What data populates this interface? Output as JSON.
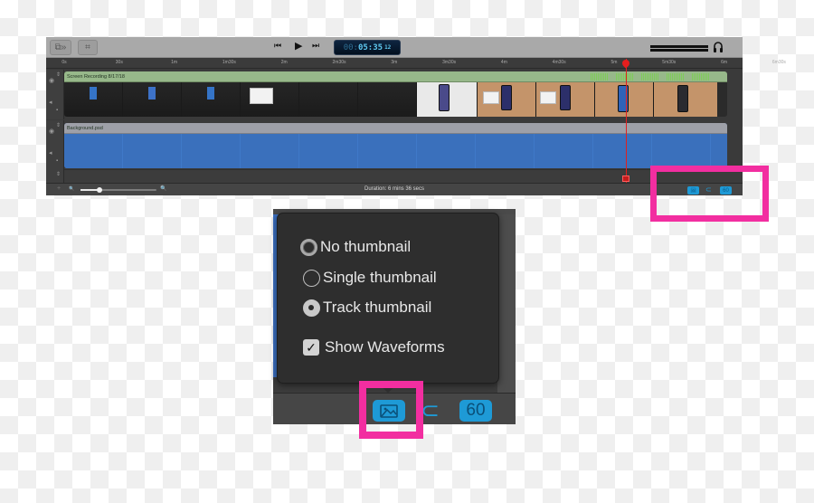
{
  "toolbar": {
    "left_buttons": [
      {
        "icon": "media-library-icon",
        "glyph": "⧉»"
      },
      {
        "icon": "crop-icon",
        "glyph": "⌗"
      }
    ],
    "transport": {
      "rewind_glyph": "⏮",
      "play_glyph": "▶",
      "forward_glyph": "⏭"
    },
    "timecode": {
      "hours": "00:",
      "main": "05:35",
      "frames": "12"
    },
    "headphones_icon": "headphones-icon"
  },
  "ruler": {
    "ticks": [
      "0s",
      "30s",
      "1m",
      "1m30s",
      "2m",
      "2m30s",
      "3m",
      "3m30s",
      "4m",
      "4m30s",
      "5m",
      "5m30s",
      "6m",
      "6m30s"
    ]
  },
  "playhead": {
    "time": "5m35s"
  },
  "tracks": [
    {
      "name": "Screen Recording 8/17/18",
      "type": "video",
      "color": "#97b88a"
    },
    {
      "name": "Background.psd",
      "type": "image",
      "color": "#3d75c4"
    }
  ],
  "statusbar": {
    "duration": "Duration: 6 mins 36 secs",
    "add_glyph": "+",
    "zoom_out_glyph": "🔍",
    "zoom_in_glyph": "🔍",
    "zoom_level": 0.25,
    "thumbnail_glyph": "🖼",
    "snap_glyph": "⊂",
    "fps": "60"
  },
  "popover": {
    "options": [
      {
        "label": "No thumbnail",
        "selected": false,
        "focused": true
      },
      {
        "label": "Single thumbnail",
        "selected": false,
        "focused": false
      },
      {
        "label": "Track thumbnail",
        "selected": true,
        "focused": false
      }
    ],
    "show_waveforms": {
      "label": "Show Waveforms",
      "checked": true,
      "check_glyph": "✓"
    }
  },
  "inset_bar": {
    "thumbnail_glyph": "🖼",
    "snap_glyph": "⊂",
    "fps": "60"
  },
  "colors": {
    "accent": "#1e9ad6",
    "highlight": "#f22ea0",
    "playhead": "#e02020"
  }
}
